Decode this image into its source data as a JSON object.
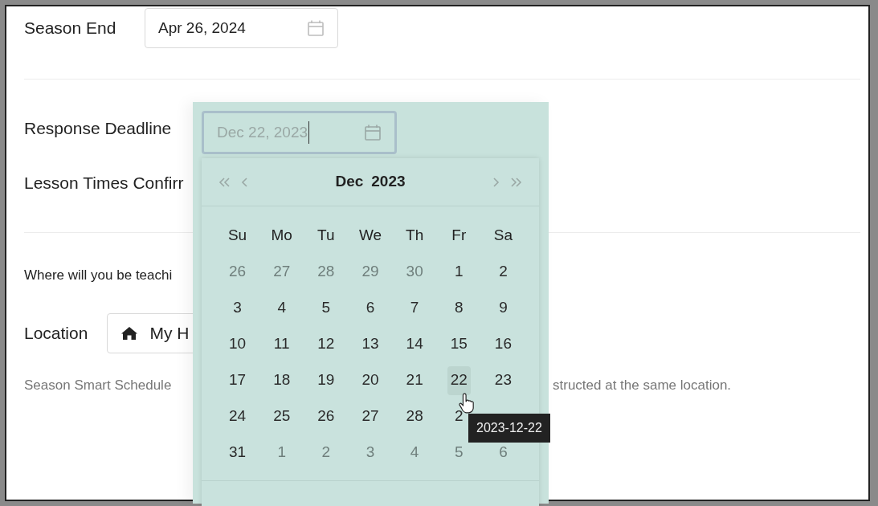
{
  "season_end": {
    "label": "Season End",
    "value": "Apr 26, 2024"
  },
  "response_deadline": {
    "label": "Response Deadline",
    "value": "Dec 22, 2023"
  },
  "lesson_times": {
    "label": "Lesson Times Confirr"
  },
  "location_question": "Where will you be teachi",
  "location": {
    "label": "Location",
    "value": "My H"
  },
  "note": {
    "left": "Season Smart Schedule",
    "right": "structed at the same location."
  },
  "calendar": {
    "month": "Dec",
    "year": "2023",
    "weekdays": [
      "Su",
      "Mo",
      "Tu",
      "We",
      "Th",
      "Fr",
      "Sa"
    ],
    "days": [
      {
        "label": "26",
        "outside": true,
        "hovered": false
      },
      {
        "label": "27",
        "outside": true,
        "hovered": false
      },
      {
        "label": "28",
        "outside": true,
        "hovered": false
      },
      {
        "label": "29",
        "outside": true,
        "hovered": false
      },
      {
        "label": "30",
        "outside": true,
        "hovered": false
      },
      {
        "label": "1",
        "outside": false,
        "hovered": false
      },
      {
        "label": "2",
        "outside": false,
        "hovered": false
      },
      {
        "label": "3",
        "outside": false,
        "hovered": false
      },
      {
        "label": "4",
        "outside": false,
        "hovered": false
      },
      {
        "label": "5",
        "outside": false,
        "hovered": false
      },
      {
        "label": "6",
        "outside": false,
        "hovered": false
      },
      {
        "label": "7",
        "outside": false,
        "hovered": false
      },
      {
        "label": "8",
        "outside": false,
        "hovered": false
      },
      {
        "label": "9",
        "outside": false,
        "hovered": false
      },
      {
        "label": "10",
        "outside": false,
        "hovered": false
      },
      {
        "label": "11",
        "outside": false,
        "hovered": false
      },
      {
        "label": "12",
        "outside": false,
        "hovered": false
      },
      {
        "label": "13",
        "outside": false,
        "hovered": false
      },
      {
        "label": "14",
        "outside": false,
        "hovered": false
      },
      {
        "label": "15",
        "outside": false,
        "hovered": false
      },
      {
        "label": "16",
        "outside": false,
        "hovered": false
      },
      {
        "label": "17",
        "outside": false,
        "hovered": false
      },
      {
        "label": "18",
        "outside": false,
        "hovered": false
      },
      {
        "label": "19",
        "outside": false,
        "hovered": false
      },
      {
        "label": "20",
        "outside": false,
        "hovered": false
      },
      {
        "label": "21",
        "outside": false,
        "hovered": false
      },
      {
        "label": "22",
        "outside": false,
        "hovered": true
      },
      {
        "label": "23",
        "outside": false,
        "hovered": false
      },
      {
        "label": "24",
        "outside": false,
        "hovered": false
      },
      {
        "label": "25",
        "outside": false,
        "hovered": false
      },
      {
        "label": "26",
        "outside": false,
        "hovered": false
      },
      {
        "label": "27",
        "outside": false,
        "hovered": false
      },
      {
        "label": "28",
        "outside": false,
        "hovered": false
      },
      {
        "label": "2",
        "outside": false,
        "hovered": false
      },
      {
        "label": "31",
        "outside": false,
        "hovered": false
      },
      {
        "label": "1",
        "outside": true,
        "hovered": false
      },
      {
        "label": "2",
        "outside": true,
        "hovered": false
      },
      {
        "label": "3",
        "outside": true,
        "hovered": false
      },
      {
        "label": "4",
        "outside": true,
        "hovered": false
      },
      {
        "label": "5",
        "outside": true,
        "hovered": false
      },
      {
        "label": "6",
        "outside": true,
        "hovered": false
      }
    ],
    "tooltip": "2023-12-22"
  }
}
